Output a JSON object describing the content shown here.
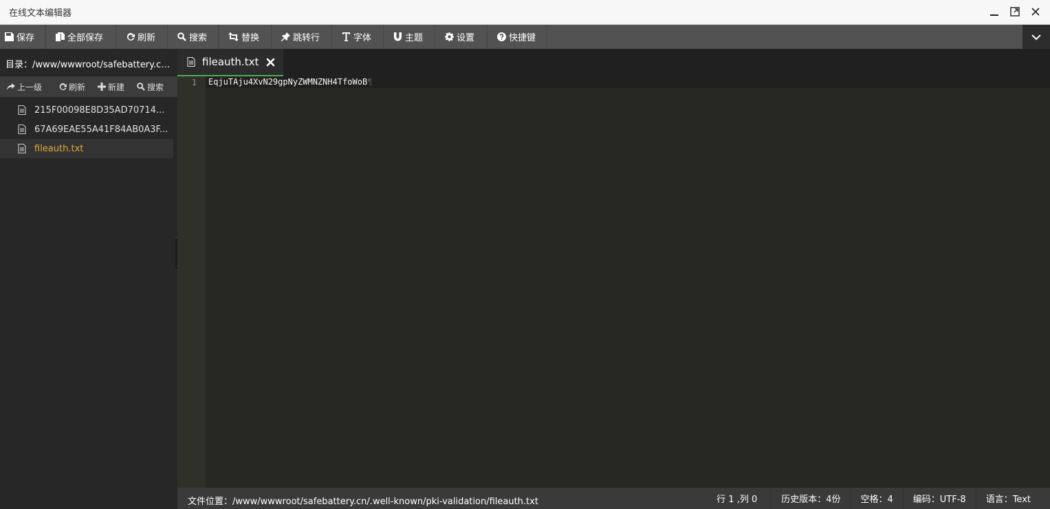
{
  "window": {
    "title": "在线文本编辑器"
  },
  "toolbar": {
    "save": "保存",
    "save_all": "全部保存",
    "refresh": "刷新",
    "search": "搜索",
    "replace": "替换",
    "goto_line": "跳转行",
    "font": "字体",
    "theme": "主题",
    "settings": "设置",
    "shortcuts": "快捷键"
  },
  "sidebar": {
    "directory": "目录：/www/wwwroot/safebattery.cn/....",
    "tools": {
      "up": "上一级",
      "refresh": "刷新",
      "new": "新建",
      "search": "搜索"
    },
    "files": [
      {
        "name": "215F00098E8D35AD70714..."
      },
      {
        "name": "67A69EAE55A41F84AB0A3F..."
      },
      {
        "name": "fileauth.txt"
      }
    ]
  },
  "tab": {
    "label": "fileauth.txt"
  },
  "editor": {
    "line_number": "1",
    "content": "EqjuTAju4XvN29gpNyZWMNZNH4TfoWoB",
    "pilcrow": "¶"
  },
  "status": {
    "path": "文件位置：/www/wwwroot/safebattery.cn/.well-known/pki-validation/fileauth.txt",
    "cursor": "行 1 ,列 0",
    "history": "历史版本：4份",
    "indent": "空格：4",
    "encoding": "编码：UTF-8",
    "language": "语言：Text"
  },
  "colors": {
    "accent_tab": "#4caf50",
    "active_file": "#e8a93b",
    "editor_bg": "#272822"
  }
}
